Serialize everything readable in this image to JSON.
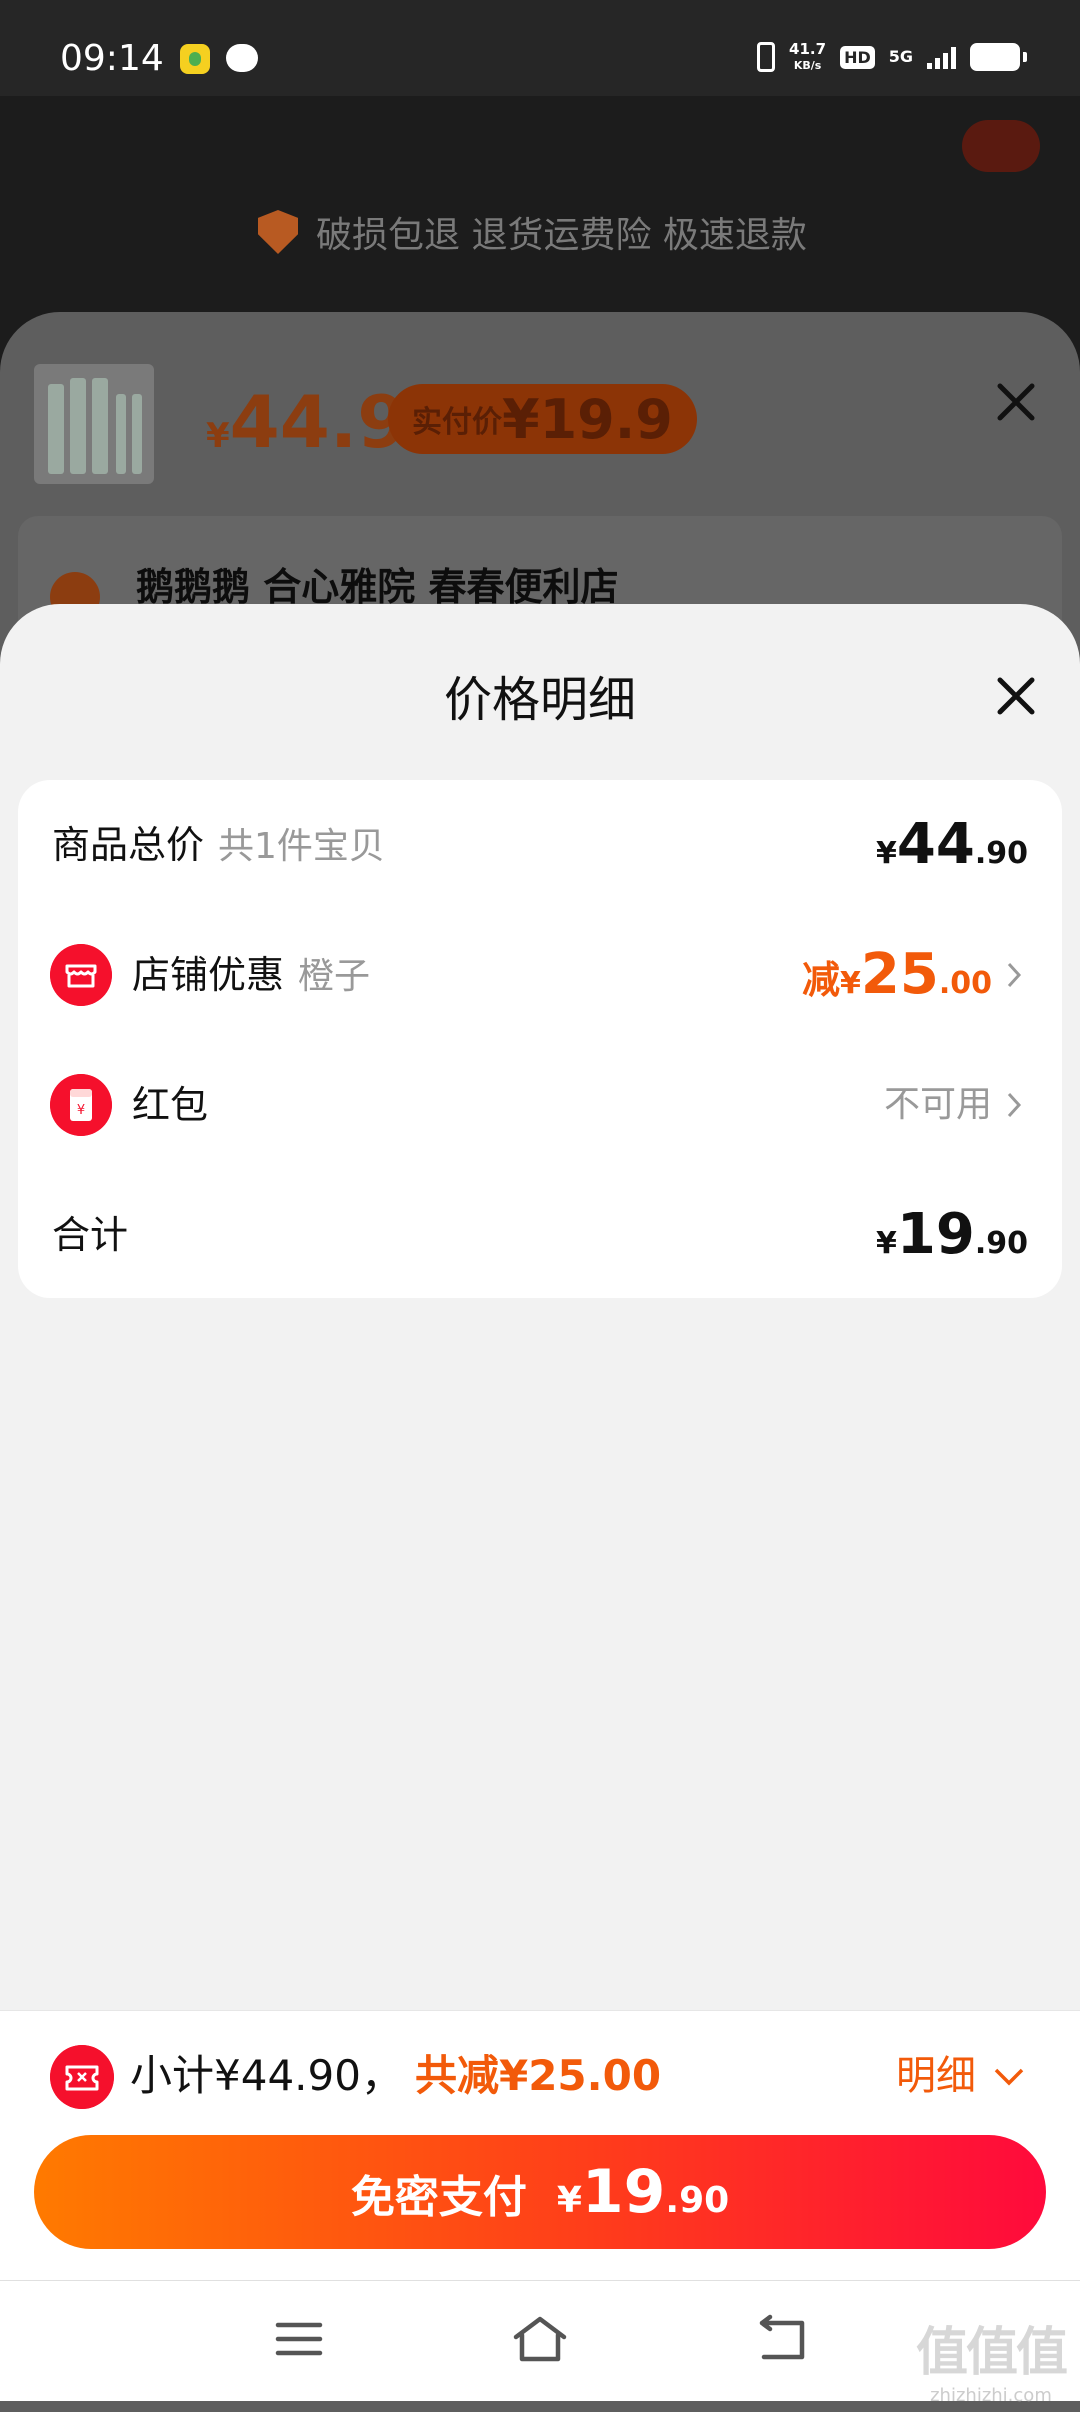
{
  "status_bar": {
    "time": "09:14",
    "net_speed_value": "41.7",
    "net_speed_unit": "KB/s",
    "hd": "HD",
    "network": "5G"
  },
  "background": {
    "guarantee_text": "破损包退 退货运费险 极速退款",
    "product_price_currency": "¥",
    "product_price": "44.9",
    "actual_price_label": "实付价",
    "actual_price_value": "¥19.9",
    "shop_name": "鹅鹅鹅 合心雅院  春春便利店"
  },
  "price_sheet": {
    "title": "价格明细",
    "rows": [
      {
        "label": "商品总价",
        "sub": "共1件宝贝",
        "currency": "¥",
        "int": "44",
        "dec": ".90"
      },
      {
        "label": "店铺优惠",
        "sub": "橙子",
        "prefix": "减",
        "currency": "¥",
        "int": "25",
        "dec": ".00"
      },
      {
        "label": "红包",
        "value_text": "不可用"
      },
      {
        "label": "合计",
        "currency": "¥",
        "int": "19",
        "dec": ".90"
      }
    ]
  },
  "summary": {
    "subtotal_text": "小计¥44.90，",
    "saved_text": "共减¥25.00",
    "detail_label": "明细"
  },
  "pay_button": {
    "label": "免密支付",
    "currency": "¥",
    "int": "19",
    "dec": ".90"
  },
  "watermark": {
    "big": "值值值",
    "small": "zhizhizhi.com"
  },
  "colors": {
    "accent_red": "#f5102c",
    "accent_orange": "#f25a0a",
    "button_gradient_start": "#ff7a00",
    "button_gradient_end": "#ff0a3c"
  }
}
